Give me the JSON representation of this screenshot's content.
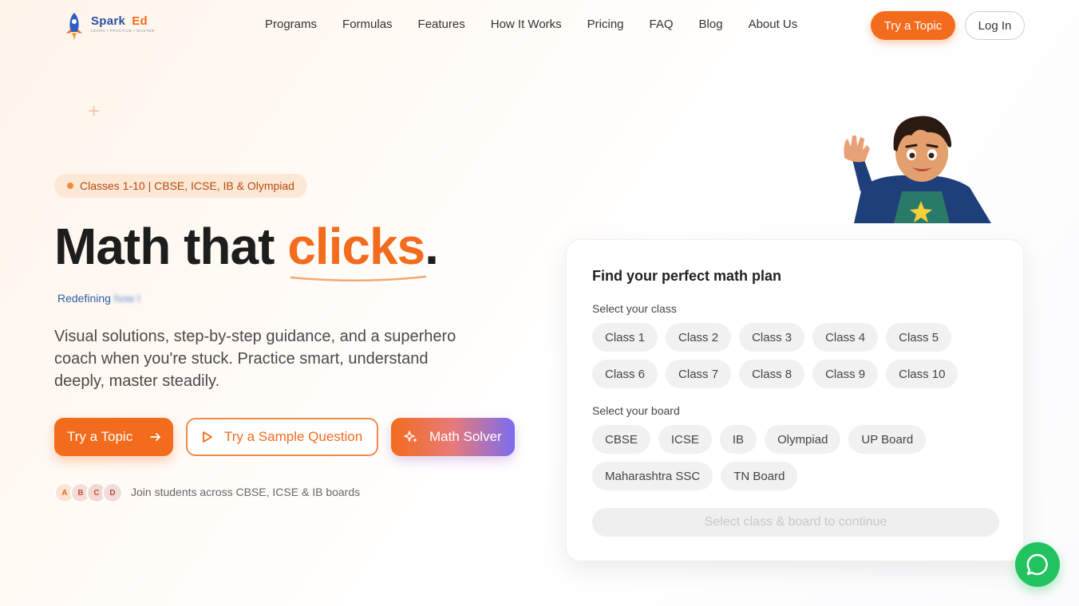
{
  "nav": {
    "logo": {
      "name": "Spark",
      "accent": "Ed",
      "tagline": "LEARN • PRACTICE • MASTER"
    },
    "links": [
      "Programs",
      "Formulas",
      "Features",
      "How It Works",
      "Pricing",
      "FAQ",
      "Blog",
      "About Us"
    ],
    "try_label": "Try a Topic",
    "login_label": "Log In"
  },
  "hero": {
    "badge": "Classes 1-10 | CBSE, ICSE, IB & Olympiad",
    "headline_before": "Math that ",
    "headline_accent": "clicks",
    "headline_after": ".",
    "redefining": "Redefining",
    "redefining_faded": "how l",
    "description": "Visual solutions, step-by-step guidance, and a superhero coach when you're stuck. Practice smart, understand deeply, master steadily.",
    "try_label": "Try a Topic",
    "sample_label": "Try a Sample Question",
    "solver_label": "Math Solver",
    "avatars": [
      "A",
      "B",
      "C",
      "D"
    ],
    "social_proof": "Join students across CBSE, ICSE & IB boards"
  },
  "plan": {
    "title": "Find your perfect math plan",
    "class_label": "Select your class",
    "classes": [
      "Class 1",
      "Class 2",
      "Class 3",
      "Class 4",
      "Class 5",
      "Class 6",
      "Class 7",
      "Class 8",
      "Class 9",
      "Class 10"
    ],
    "board_label": "Select your board",
    "boards": [
      "CBSE",
      "ICSE",
      "IB",
      "Olympiad",
      "UP Board",
      "Maharashtra SSC",
      "TN Board"
    ],
    "continue_label": "Select class & board to continue"
  },
  "colors": {
    "accent": "#f36b1c",
    "brand": "#2a4fa3",
    "whatsapp": "#22c35e"
  },
  "icons": {
    "chat": "whatsapp-icon",
    "arrow": "arrow-right-icon",
    "play": "play-icon",
    "sparkle": "sparkle-icon"
  }
}
